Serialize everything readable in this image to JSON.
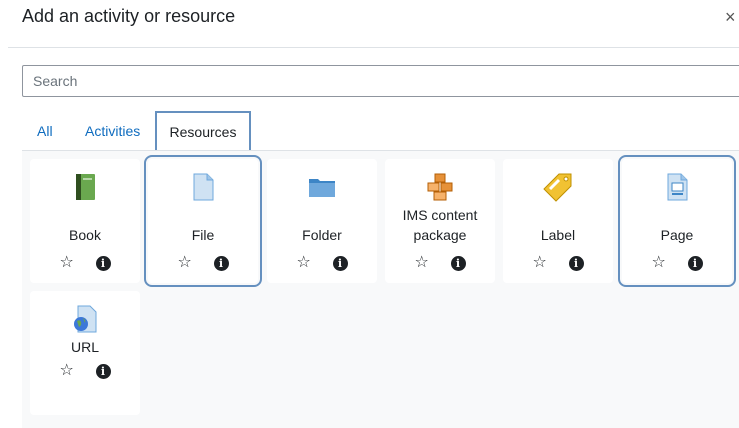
{
  "modal": {
    "title": "Add an activity or resource",
    "close_glyph": "×"
  },
  "search": {
    "placeholder": "Search",
    "value": ""
  },
  "tabs": [
    {
      "label": "All",
      "active": false
    },
    {
      "label": "Activities",
      "active": false
    },
    {
      "label": "Resources",
      "active": true
    }
  ],
  "colors": {
    "link": "#0f6cbf",
    "highlight_outline": "#6590bf",
    "panel_bg": "#f8f9fa"
  },
  "resources": [
    {
      "name": "Book",
      "icon": "book-icon",
      "highlighted": false
    },
    {
      "name": "File",
      "icon": "file-icon",
      "highlighted": true
    },
    {
      "name": "Folder",
      "icon": "folder-icon",
      "highlighted": false
    },
    {
      "name": "IMS content package",
      "name_line1": "IMS content",
      "name_line2": "package",
      "icon": "ims-content-package-icon",
      "highlighted": false
    },
    {
      "name": "Label",
      "icon": "label-icon",
      "highlighted": false
    },
    {
      "name": "Page",
      "icon": "page-icon",
      "highlighted": true
    },
    {
      "name": "URL",
      "icon": "url-icon",
      "highlighted": false
    }
  ],
  "card_actions": {
    "star_glyph": "☆",
    "info_glyph": "i"
  }
}
